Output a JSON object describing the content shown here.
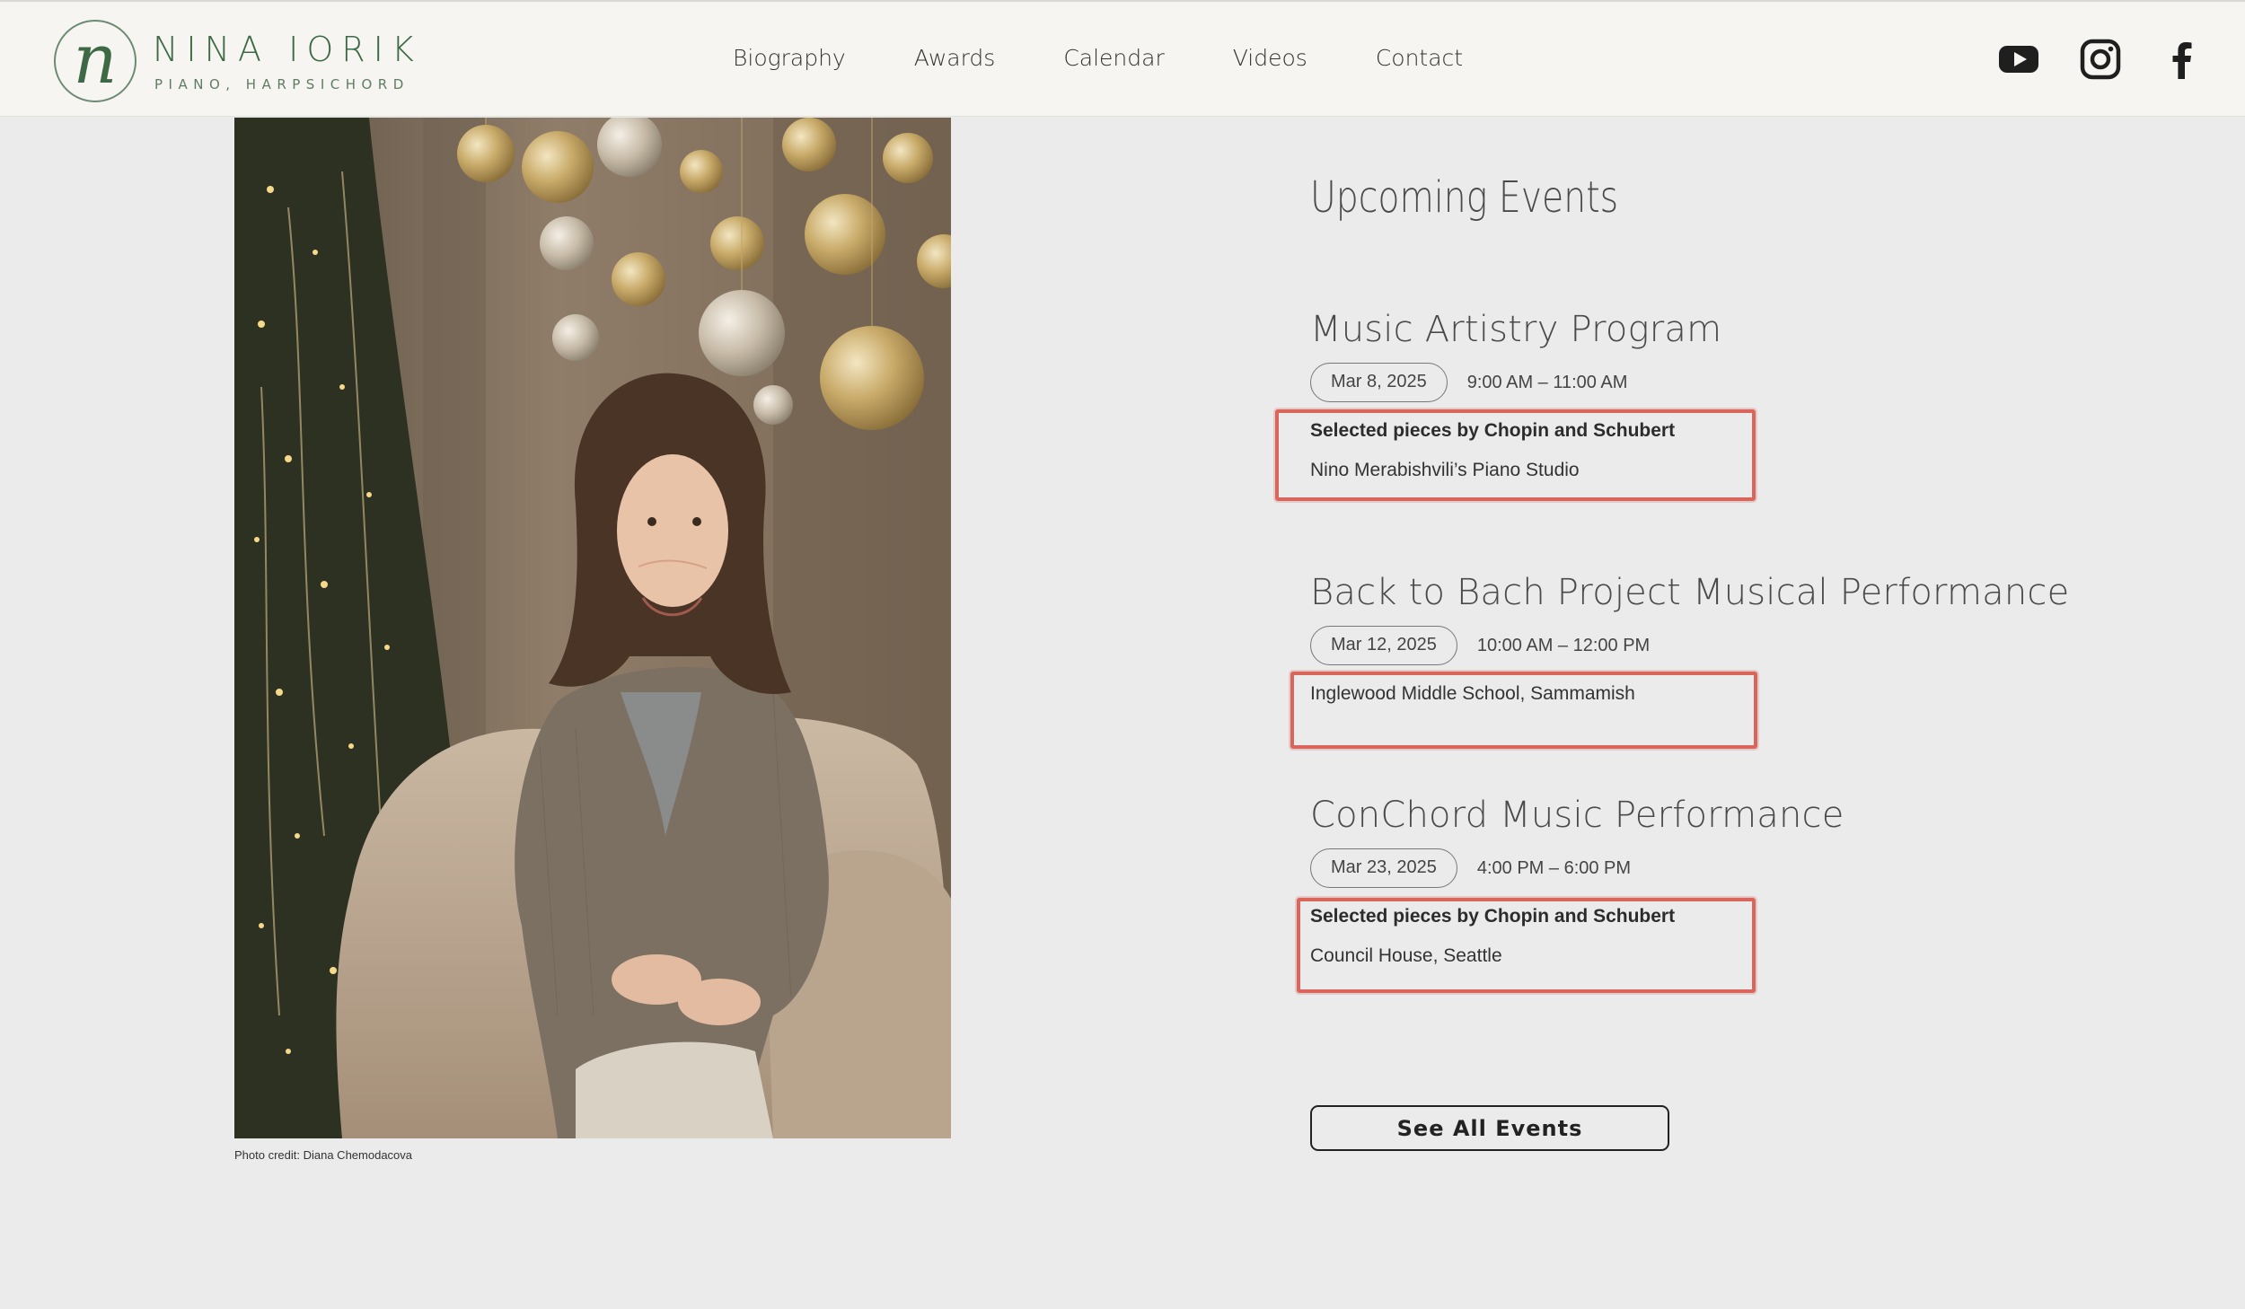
{
  "brand": {
    "monogram": "n",
    "name": "NINA IORIK",
    "tagline": "PIANO, HARPSICHORD"
  },
  "nav": {
    "items": [
      "Biography",
      "Awards",
      "Calendar",
      "Videos",
      "Contact"
    ]
  },
  "social": {
    "icons": [
      "youtube-icon",
      "instagram-icon",
      "facebook-icon"
    ]
  },
  "photo": {
    "credit": "Photo credit: Diana Chemodacova"
  },
  "events": {
    "heading": "Upcoming Events",
    "items": [
      {
        "title": "Music Artistry Program",
        "date": "Mar 8, 2025",
        "time": "9:00 AM – 11:00 AM",
        "program": "Selected pieces by Chopin and Schubert",
        "venue": "Nino Merabishvili’s Piano Studio"
      },
      {
        "title": "Back to Bach Project Musical Performance",
        "date": "Mar 12, 2025",
        "time": "10:00 AM – 12:00 PM",
        "program": "",
        "venue": "Inglewood Middle School, Sammamish"
      },
      {
        "title": "ConChord Music Performance",
        "date": "Mar 23, 2025",
        "time": "4:00 PM – 6:00 PM",
        "program": "Selected pieces by Chopin and Schubert",
        "venue": "Council House, Seattle"
      }
    ],
    "see_all_label": "See All Events"
  },
  "colors": {
    "brand_green": "#3d6a45",
    "highlight_red": "#d9665c",
    "header_bg": "#f6f5f1",
    "page_bg": "#ebebeb"
  }
}
